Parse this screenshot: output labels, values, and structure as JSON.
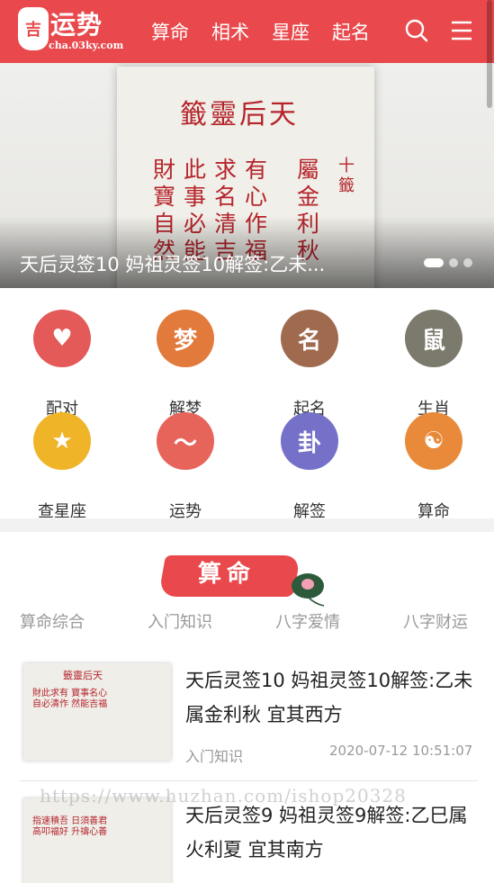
{
  "header": {
    "logo_badge": "吉",
    "logo_title": "运势",
    "logo_url": "cha.03ky.com",
    "nav": [
      "算命",
      "相术",
      "星座",
      "起名"
    ],
    "search_icon": "search-icon",
    "menu_icon": "menu-icon",
    "brand_color": "#e9494c"
  },
  "banner": {
    "slip_title": "籤靈后天",
    "slip_cols": [
      "十籤",
      "屬金利秋",
      "有心作福",
      "求名清吉",
      "此事必能",
      "財寶自然"
    ],
    "caption": "天后灵签10 妈祖灵签10解签:乙未...",
    "dots": 3,
    "active_dot": 1
  },
  "grid": [
    {
      "label": "配对",
      "glyph": "♥",
      "color": "#e35a58"
    },
    {
      "label": "解梦",
      "glyph": "梦",
      "color": "#e27a3c"
    },
    {
      "label": "起名",
      "glyph": "名",
      "color": "#a06a4f"
    },
    {
      "label": "生肖",
      "glyph": "鼠",
      "color": "#7c7a6c"
    },
    {
      "label": "查星座",
      "glyph": "★",
      "color": "#f0b429"
    },
    {
      "label": "运势",
      "glyph": "〜",
      "color": "#e7645b"
    },
    {
      "label": "解签",
      "glyph": "卦",
      "color": "#7571c9"
    },
    {
      "label": "算命",
      "glyph": "☯",
      "color": "#e88a3a"
    }
  ],
  "section": {
    "title": "算命",
    "tabs": [
      "算命综合",
      "入门知识",
      "八字爱情",
      "八字财运"
    ]
  },
  "articles": [
    {
      "title": "天后灵签10 妈祖灵签10解签:乙未属金利秋 宜其西方",
      "category": "入门知识",
      "time": "2020-07-12 10:51:07",
      "thumb_title": "籤靈后天",
      "thumb_text": "財此求有 寶事名心 自必清作 然能吉福"
    },
    {
      "title": "天后灵签9 妈祖灵签9解签:乙巳属火利夏 宜其南方",
      "category": "",
      "time": "",
      "thumb_title": "",
      "thumb_text": "指速積吾 日須善君 高叩福好 升禱心善"
    }
  ],
  "watermark": "https://www.huzhan.com/ishop20328"
}
